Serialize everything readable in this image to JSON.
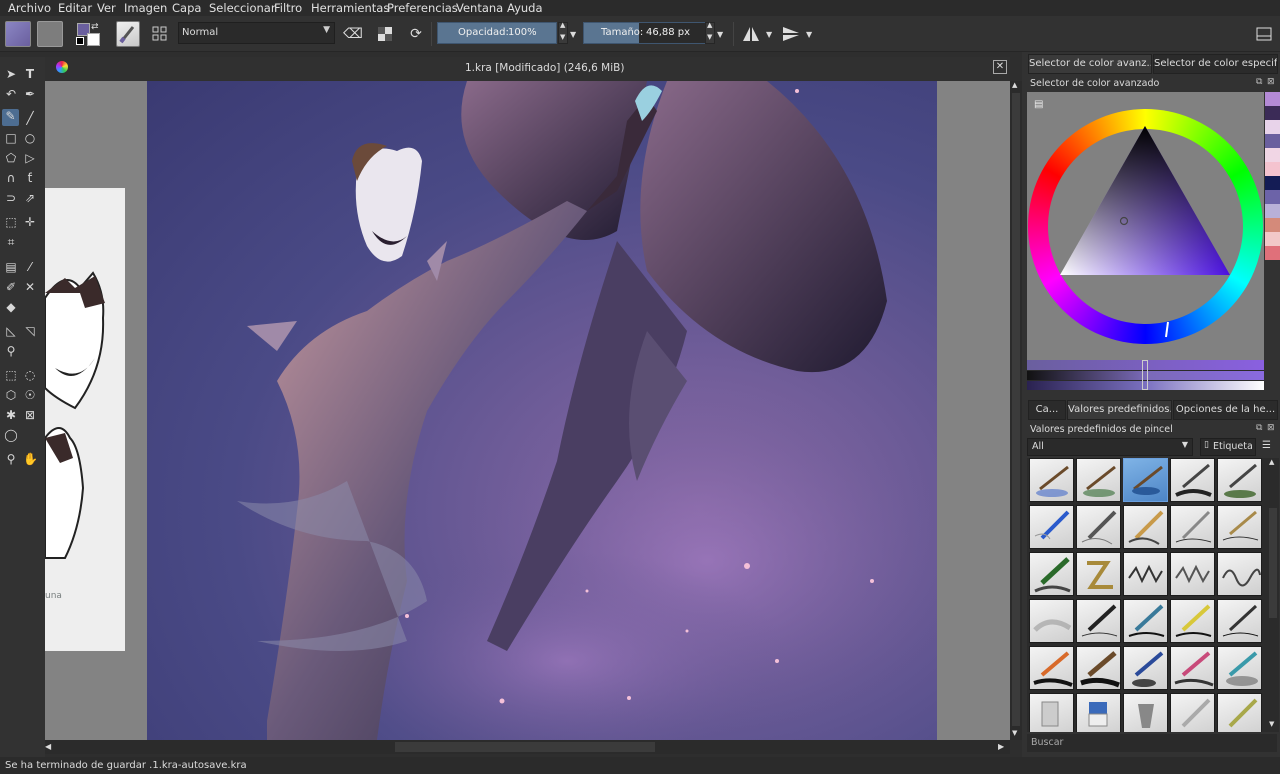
{
  "menu": [
    "Archivo",
    "Editar",
    "Ver",
    "Imagen",
    "Capa",
    "Seleccionar",
    "Filtro",
    "Herramientas",
    "Preferencias",
    "Ventana",
    "Ayuda"
  ],
  "toolbar": {
    "blend_mode": "Normal",
    "opacity_label": "Opacidad:",
    "opacity_value": "100%",
    "size_label": "Tamaño:",
    "size_value": "46,88 px",
    "fg_color": "#6a5f9e",
    "bg_color": "#ffffff"
  },
  "document": {
    "title": "1.kra [Modificado]  (246,6 MiB)"
  },
  "right_panel": {
    "tabs_top": [
      "Selector de color avanz...",
      "Selector de color especif..."
    ],
    "color_selector_title": "Selector de color avanzado",
    "tabs_mid": [
      "Ca...",
      "Valores predefinidos...",
      "Opciones de la he..."
    ],
    "brush_presets_title": "Valores predefinidos de pincel",
    "filter_value": "All",
    "tag_label": "Etiqueta",
    "search_placeholder": "Buscar"
  },
  "palette": [
    "#b48ad6",
    "#3b2b57",
    "#e8d3ea",
    "#6a5f9e",
    "#f1d6e5",
    "#f4c3cf",
    "#141c55",
    "#6c63a8",
    "#b8b0d8",
    "#d48a7a",
    "#f2c8c8",
    "#e0707a"
  ],
  "status": {
    "message": "Se ha terminado de guardar .1.kra-autosave.kra"
  }
}
